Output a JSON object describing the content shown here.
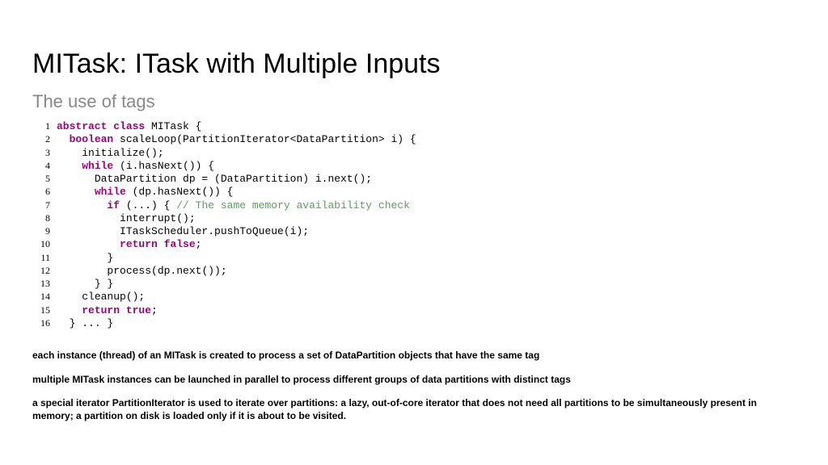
{
  "title": "MITask: ITask with Multiple Inputs",
  "subtitle": "The use of tags",
  "code": [
    {
      "n": "1",
      "ind": "",
      "segs": [
        {
          "t": "abstract class ",
          "c": "kw"
        },
        {
          "t": "MITask {",
          "c": ""
        }
      ]
    },
    {
      "n": "2",
      "ind": "  ",
      "segs": [
        {
          "t": "boolean ",
          "c": "kw"
        },
        {
          "t": "scaleLoop(PartitionIterator<DataPartition> i) {",
          "c": ""
        }
      ]
    },
    {
      "n": "3",
      "ind": "    ",
      "segs": [
        {
          "t": "initialize();",
          "c": ""
        }
      ]
    },
    {
      "n": "4",
      "ind": "    ",
      "segs": [
        {
          "t": "while ",
          "c": "kw"
        },
        {
          "t": "(i.hasNext()) {",
          "c": ""
        }
      ]
    },
    {
      "n": "5",
      "ind": "      ",
      "segs": [
        {
          "t": "DataPartition dp = (DataPartition) i.next();",
          "c": ""
        }
      ]
    },
    {
      "n": "6",
      "ind": "      ",
      "segs": [
        {
          "t": "while ",
          "c": "kw"
        },
        {
          "t": "(dp.hasNext()) {",
          "c": ""
        }
      ]
    },
    {
      "n": "7",
      "ind": "        ",
      "segs": [
        {
          "t": "if ",
          "c": "kw"
        },
        {
          "t": "(...) { ",
          "c": ""
        },
        {
          "t": "// The same memory availability check",
          "c": "cm"
        }
      ]
    },
    {
      "n": "8",
      "ind": "          ",
      "segs": [
        {
          "t": "interrupt();",
          "c": ""
        }
      ]
    },
    {
      "n": "9",
      "ind": "          ",
      "segs": [
        {
          "t": "ITaskScheduler.pushToQueue(i);",
          "c": ""
        }
      ]
    },
    {
      "n": "10",
      "ind": "          ",
      "segs": [
        {
          "t": "return false",
          "c": "kw"
        },
        {
          "t": ";",
          "c": ""
        }
      ]
    },
    {
      "n": "11",
      "ind": "        ",
      "segs": [
        {
          "t": "}",
          "c": ""
        }
      ]
    },
    {
      "n": "12",
      "ind": "        ",
      "segs": [
        {
          "t": "process(dp.next());",
          "c": ""
        }
      ]
    },
    {
      "n": "13",
      "ind": "      ",
      "segs": [
        {
          "t": "} }",
          "c": ""
        }
      ]
    },
    {
      "n": "14",
      "ind": "    ",
      "segs": [
        {
          "t": "cleanup();",
          "c": ""
        }
      ]
    },
    {
      "n": "15",
      "ind": "    ",
      "segs": [
        {
          "t": "return true",
          "c": "kw"
        },
        {
          "t": ";",
          "c": ""
        }
      ]
    },
    {
      "n": "16",
      "ind": "  ",
      "segs": [
        {
          "t": "} ... }",
          "c": ""
        }
      ]
    }
  ],
  "notes": [
    "each instance (thread) of an MITask is created to process a set of DataPartition objects that have the same tag",
    "multiple MITask instances can be launched in parallel to process different groups of data partitions with distinct tags",
    "a special iterator PartitionIterator is used to iterate over partitions: a lazy, out-of-core iterator that does not need all partitions to be simultaneously present in memory; a partition on disk is loaded only if it is about to be visited."
  ]
}
